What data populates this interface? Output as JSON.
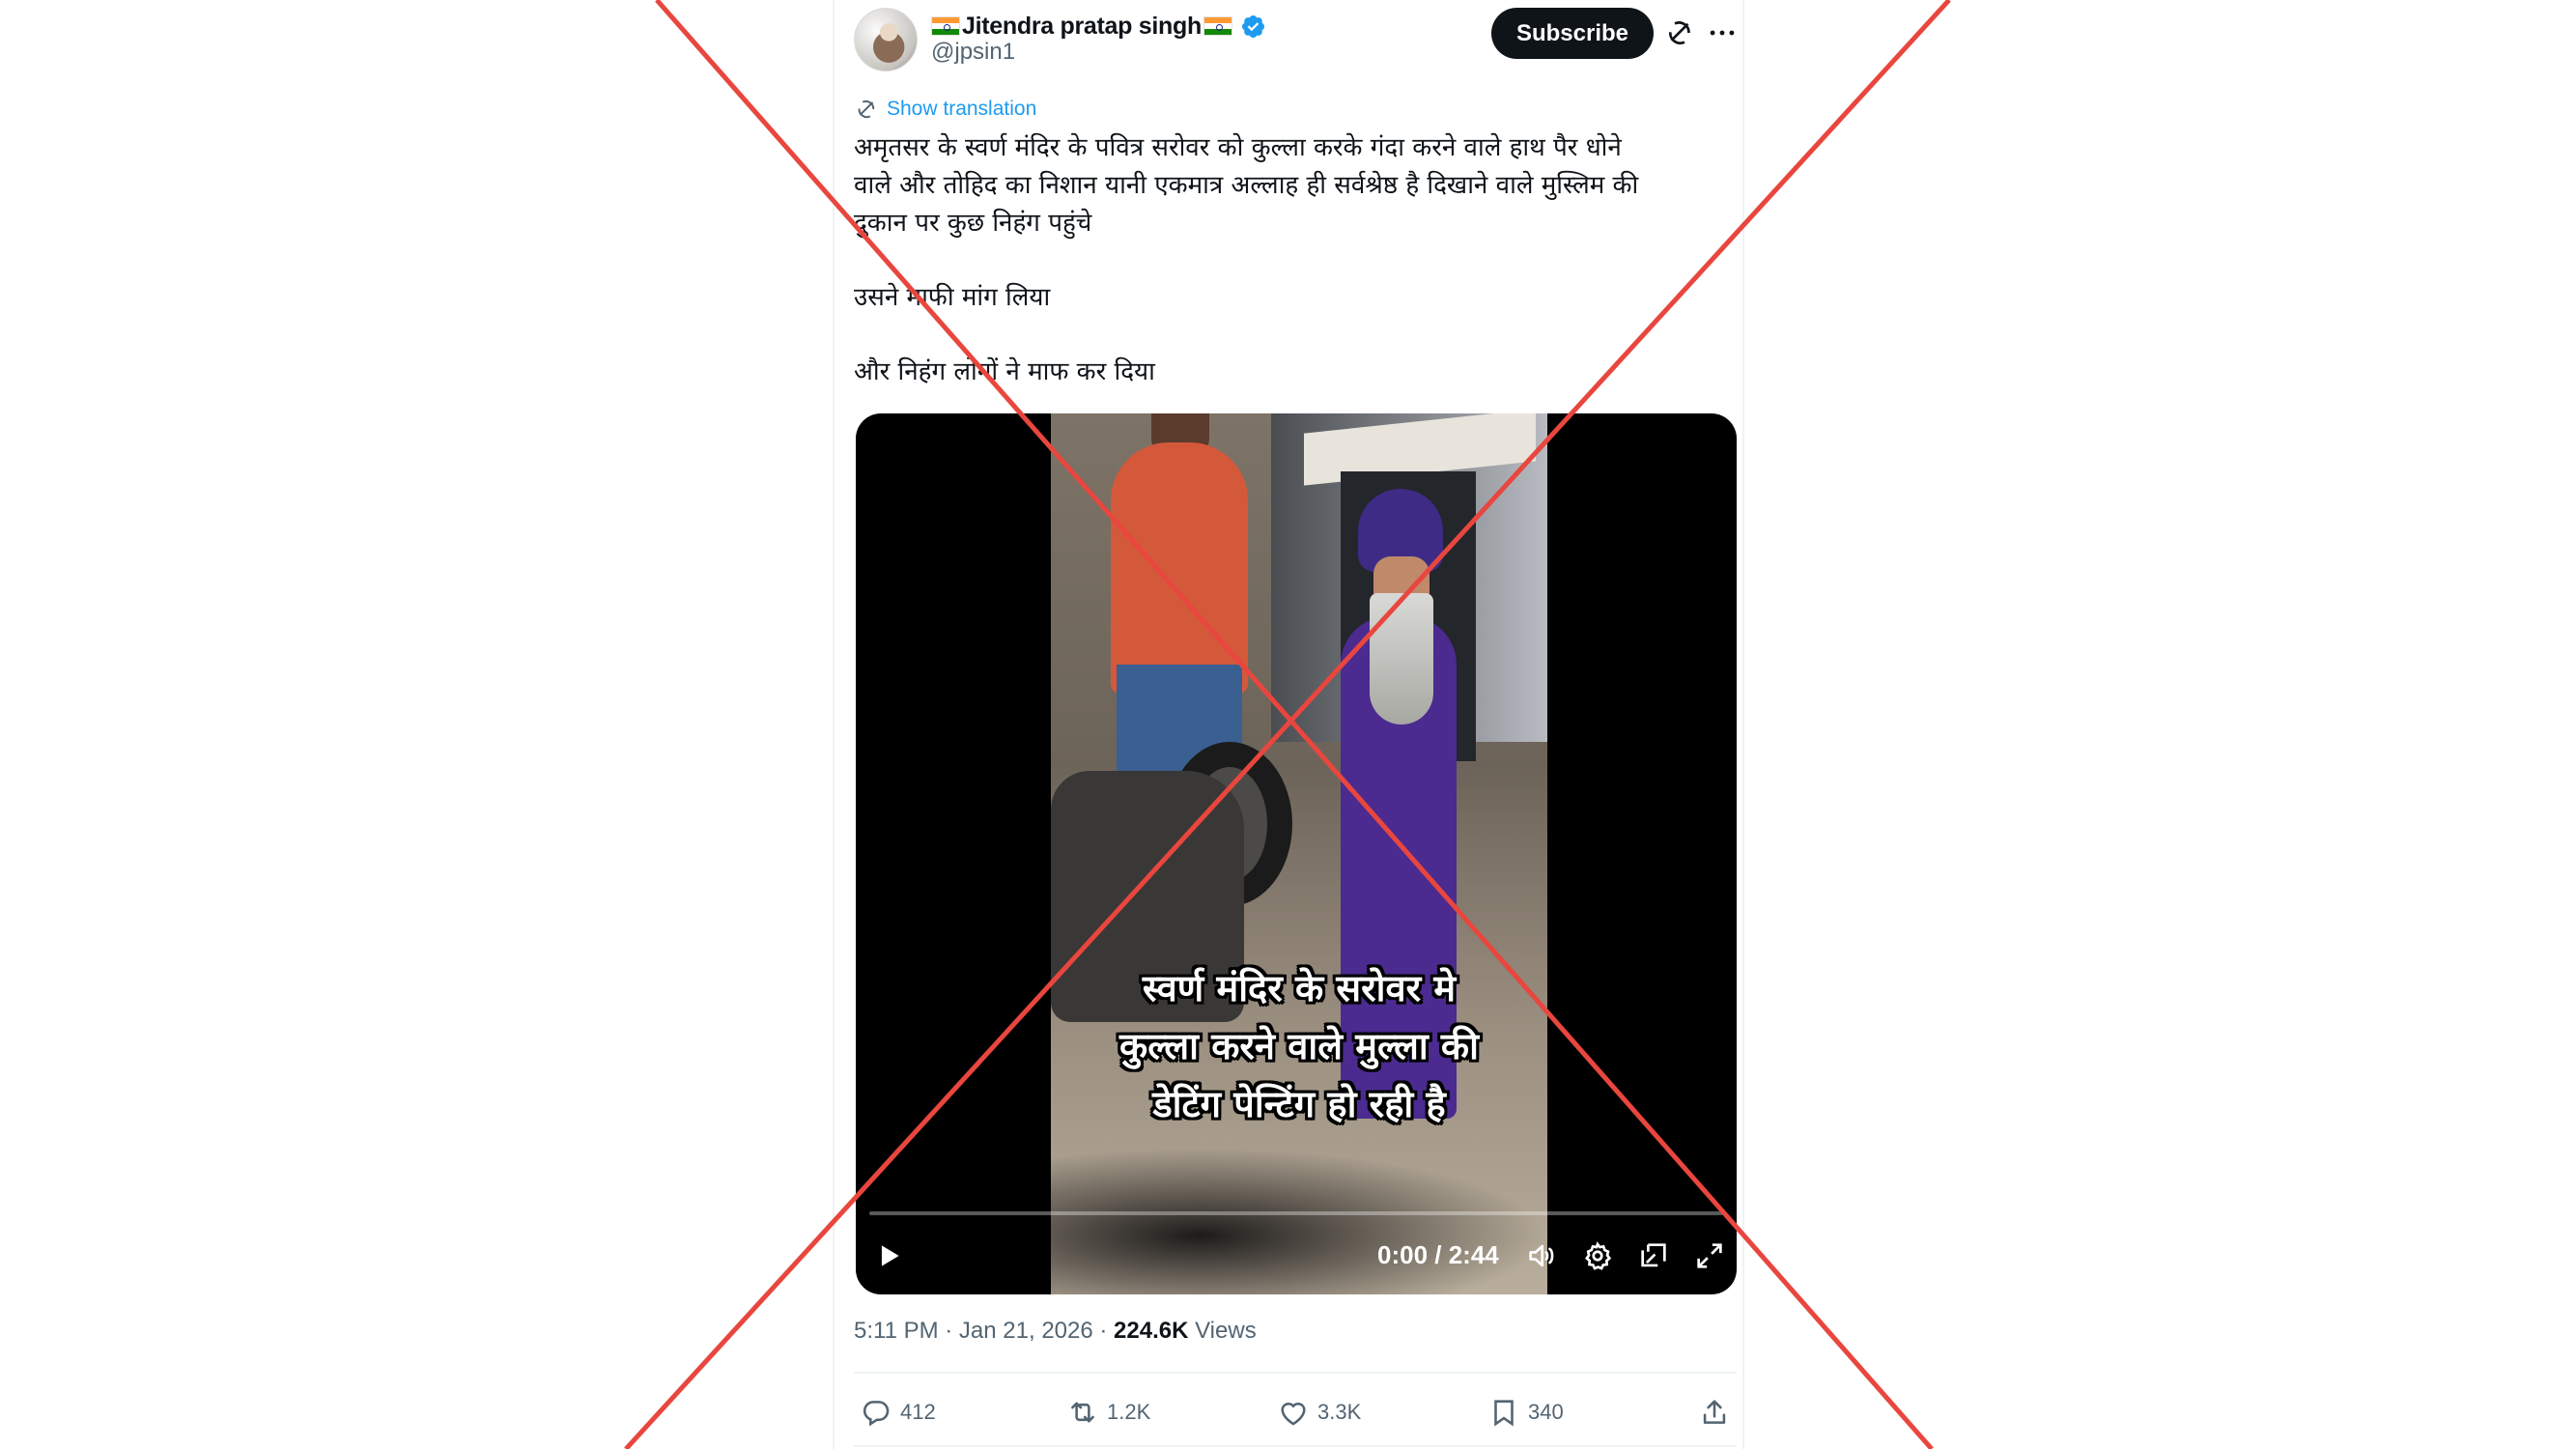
{
  "author": {
    "display_name": "Jitendra pratap singh",
    "handle": "@jpsin1",
    "verified": true
  },
  "header": {
    "subscribe_label": "Subscribe"
  },
  "translation": {
    "label": "Show translation"
  },
  "tweet": {
    "line1": "अमृतसर के स्वर्ण मंदिर के पवित्र सरोवर को कुल्ला करके गंदा करने वाले हाथ पैर धोने",
    "line2": "वाले और  तोहिद का निशान यानी एकमात्र अल्लाह ही सर्वश्रेष्ठ है दिखाने वाले मुस्लिम की",
    "line3": "दुकान पर कुछ निहंग पहुंचे",
    "line4": "उसने माफी मांग लिया",
    "line5": "और निहंग लोगों ने माफ कर दिया"
  },
  "video": {
    "caption_line1": "स्वर्ण मंदिर के सरोवर मे",
    "caption_line2": "कुल्ला करने वाले मुल्ला की",
    "caption_line3": "डेटिंग पेन्टिंग हो रही है",
    "time": "0:00 / 2:44",
    "progress": 0
  },
  "meta": {
    "timestamp": "5:11 PM · Jan 21, 2026 · ",
    "views_count": "224.6K",
    "views_label": " Views"
  },
  "actions": {
    "replies": "412",
    "reposts": "1.2K",
    "likes": "3.3K",
    "bookmarks": "340"
  },
  "colors": {
    "accent": "#1d9bf0",
    "x_mark": "#e8463e"
  },
  "icons": [
    "verified-badge-icon",
    "grok-icon",
    "more-icon",
    "translate-icon",
    "play-icon",
    "volume-icon",
    "settings-icon",
    "pip-icon",
    "fullscreen-icon",
    "reply-icon",
    "repost-icon",
    "like-icon",
    "bookmark-icon",
    "share-icon"
  ]
}
